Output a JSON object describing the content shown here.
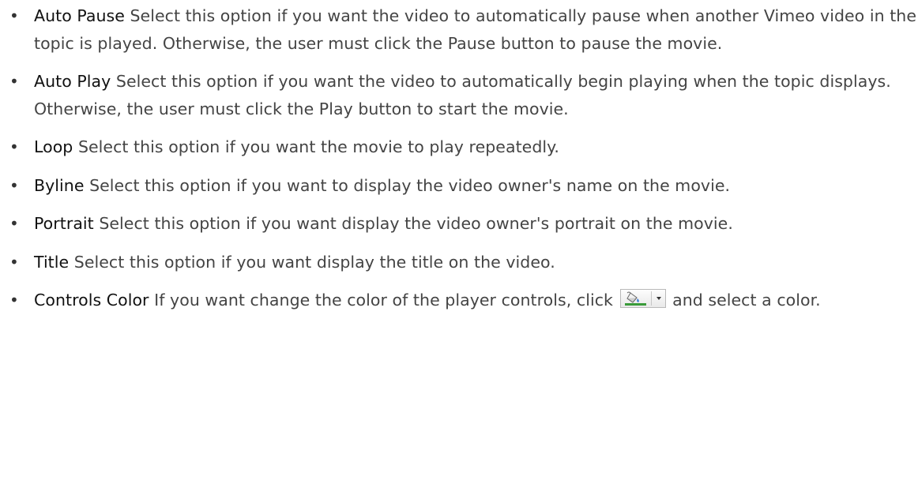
{
  "options": [
    {
      "term": "Auto Pause",
      "description": "Select this option if you want the video to automatically pause when another Vimeo video in the topic is played. Otherwise, the user must click the Pause button to pause the movie."
    },
    {
      "term": "Auto Play",
      "description": "Select this option if you want the video to automatically begin playing when the topic displays. Otherwise, the user must click the Play button to start the movie."
    },
    {
      "term": "Loop",
      "description": "Select this option if you want the movie to play repeatedly."
    },
    {
      "term": "Byline",
      "description": "Select this option if you want to display the video owner's name on the movie."
    },
    {
      "term": "Portrait",
      "description": " Select this option if you want display the video owner's portrait on the movie."
    },
    {
      "term": "Title",
      "description": "Select this option if you want display the title on the video."
    }
  ],
  "controls_color": {
    "term": "Controls Color",
    "description_before": "If you want change the color of the player controls, click",
    "description_after": "and select a color.",
    "button_icon": "fill-color-icon",
    "accent_color": "#3a9b3a"
  }
}
